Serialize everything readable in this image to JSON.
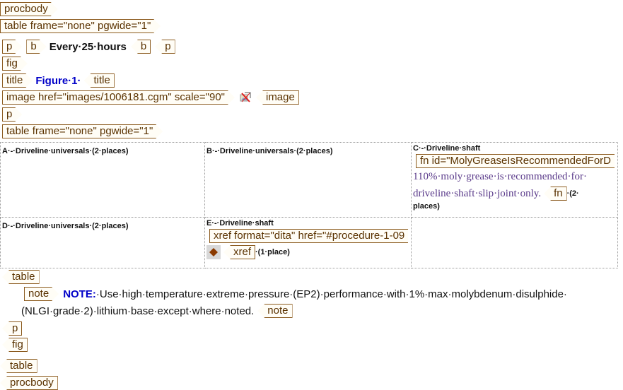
{
  "tags": {
    "procbody": "procbody",
    "table_open": "table frame=\"none\" pgwide=\"1\"",
    "p": "p",
    "b": "b",
    "fig": "fig",
    "title": "title",
    "image_open": "image href=\"images/1006181.cgm\" scale=\"90\"",
    "image": "image",
    "table": "table",
    "note": "note",
    "fn_open": "fn id=\"MolyGreaseIsRecommendedForD",
    "fn": "fn",
    "xref_open": "xref format=\"dita\" href=\"#procedure-1-09",
    "xref": "xref"
  },
  "heading_text": "Every·25·hours",
  "figure_title": "Figure·1·",
  "cells": {
    "a": "A·-·Driveline·universals·(2·places)",
    "b": "B·-·Driveline·universals·(2·places)",
    "c": "C·-·Driveline·shaft",
    "c_fn_line1": "110%·moly·grease·is·recommended·for·",
    "c_fn_line2": "driveline·shaft·slip·joint·only.",
    "c_after_fn": "·(2·",
    "c_after_fn2": "places)",
    "d": "D·-·Driveline·universals·(2·places)",
    "e": "E·-·Driveline·shaft",
    "e_after_xref": "·(1·place)"
  },
  "note": {
    "label": "NOTE:",
    "line1": "·Use·high·temperature·extreme·pressure·(EP2)·performance·with·1%·max·molybdenum·disulphide·",
    "line2": "(NLGI·grade·2)·lithium·base·except·where·noted."
  },
  "colors": {
    "tag_border": "#8b5a1e",
    "tag_text": "#5a3200",
    "title_blue": "#0000c8",
    "footnote_purple": "#5a3a8a",
    "spell_underline": "#d22"
  },
  "icons": [
    "broken-image-icon",
    "xref-diamond-icon"
  ]
}
